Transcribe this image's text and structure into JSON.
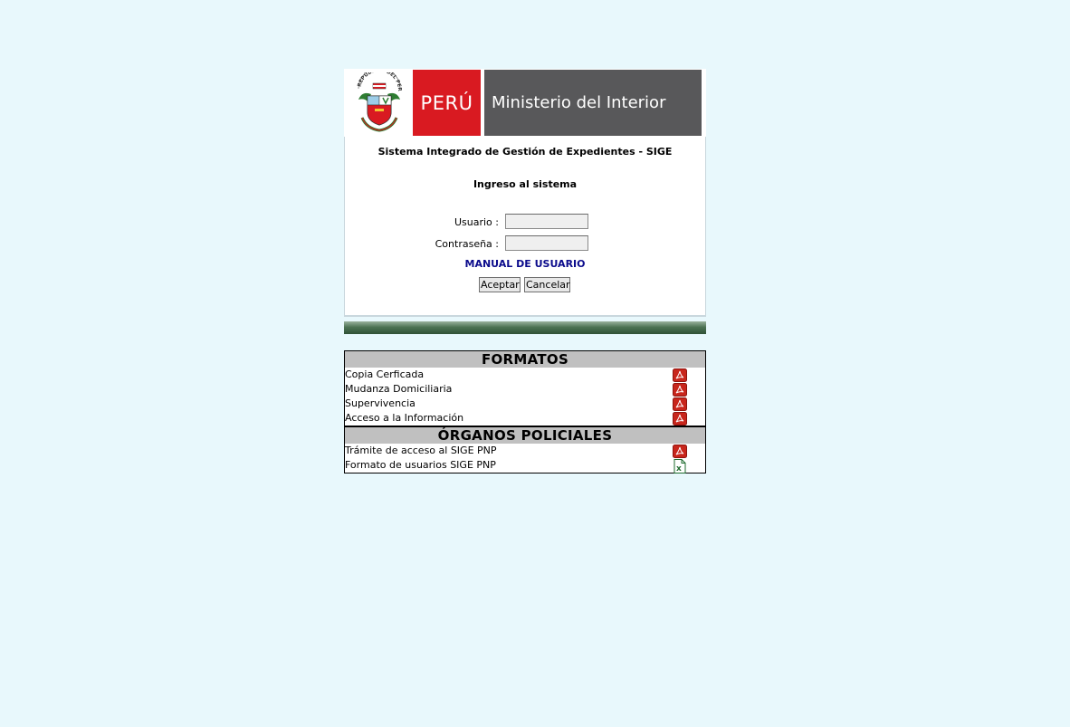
{
  "banner": {
    "country": "PERÚ",
    "ministry": "Ministerio del Interior",
    "crest_text": "REPÚBLICA DEL PERÚ"
  },
  "login": {
    "system_title": "Sistema Integrado de Gestión de Expedientes - SIGE",
    "heading": "Ingreso al sistema",
    "user_label": "Usuario :",
    "user_value": "",
    "password_label": "Contraseña :",
    "password_value": "",
    "manual_link": "MANUAL DE USUARIO",
    "accept_button": "Aceptar",
    "cancel_button": "Cancelar"
  },
  "formatos": {
    "title": "FORMATOS",
    "items": [
      {
        "label": "Copia Cerficada",
        "icon": "pdf-icon"
      },
      {
        "label": "Mudanza Domiciliaria",
        "icon": "pdf-icon"
      },
      {
        "label": "Supervivencia",
        "icon": "pdf-icon"
      },
      {
        "label": "Acceso a la Información",
        "icon": "pdf-icon"
      }
    ]
  },
  "organos": {
    "title": "ÓRGANOS POLICIALES",
    "items": [
      {
        "label": "Trámite de acceso al SIGE PNP",
        "icon": "pdf-icon"
      },
      {
        "label": "Formato de usuarios SIGE PNP",
        "icon": "excel-icon"
      }
    ]
  },
  "colors": {
    "background": "#e8f8fc",
    "peru_red": "#d91a21",
    "ministry_gray": "#58585a",
    "link_blue": "#0b0b8c"
  }
}
